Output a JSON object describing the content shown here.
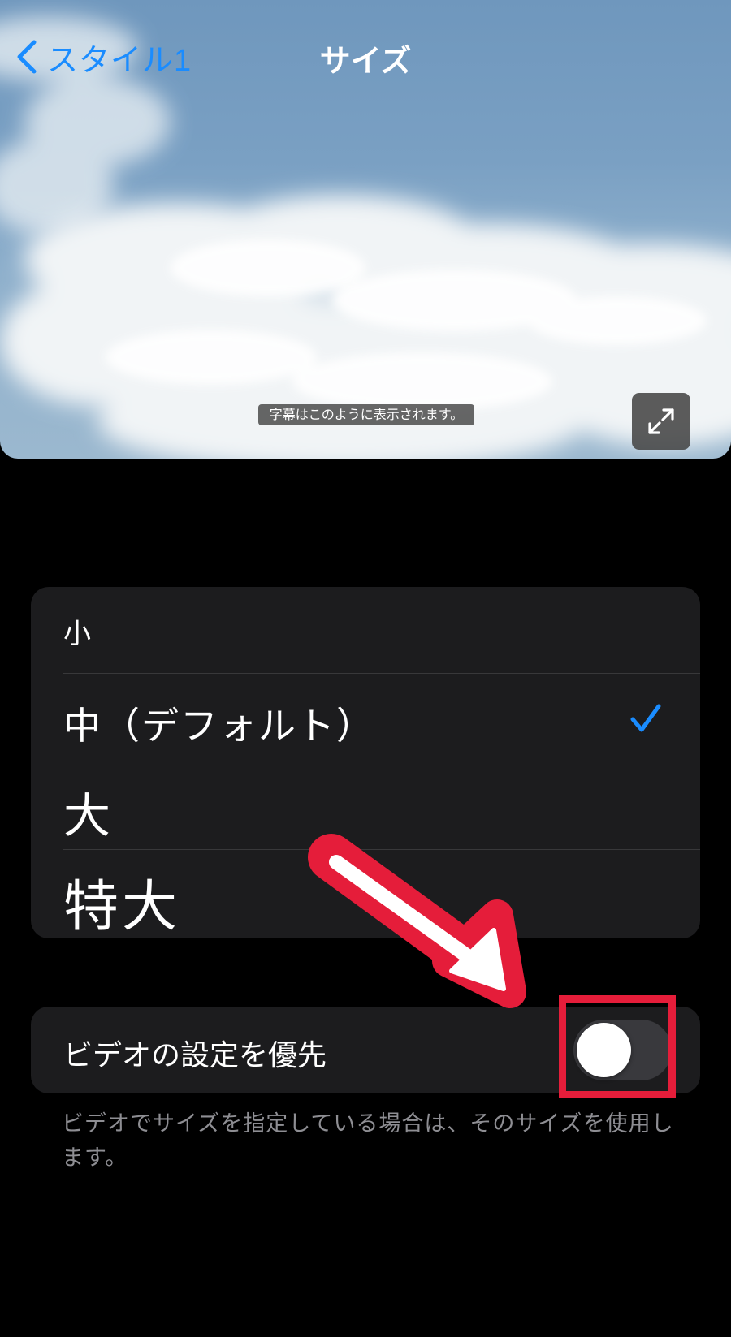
{
  "nav": {
    "back_label": "スタイル1",
    "title": "サイズ"
  },
  "preview": {
    "caption_sample": "字幕はこのように表示されます。"
  },
  "size_options": [
    {
      "label": "小",
      "selected": false
    },
    {
      "label": "中（デフォルト）",
      "selected": true
    },
    {
      "label": "大",
      "selected": false
    },
    {
      "label": "特大",
      "selected": false
    }
  ],
  "video_override": {
    "label": "ビデオの設定を優先",
    "enabled": false
  },
  "footer_note": "ビデオでサイズを指定している場合は、そのサイズを使用します。",
  "colors": {
    "accent": "#1a8cff",
    "background": "#000000",
    "group_background": "#1c1c1e",
    "annotation_red": "#e51d3a",
    "secondary_text": "#8e8e93"
  },
  "icons": {
    "back": "chevron-left-icon",
    "expand": "expand-icon",
    "selected": "checkmark-icon"
  }
}
